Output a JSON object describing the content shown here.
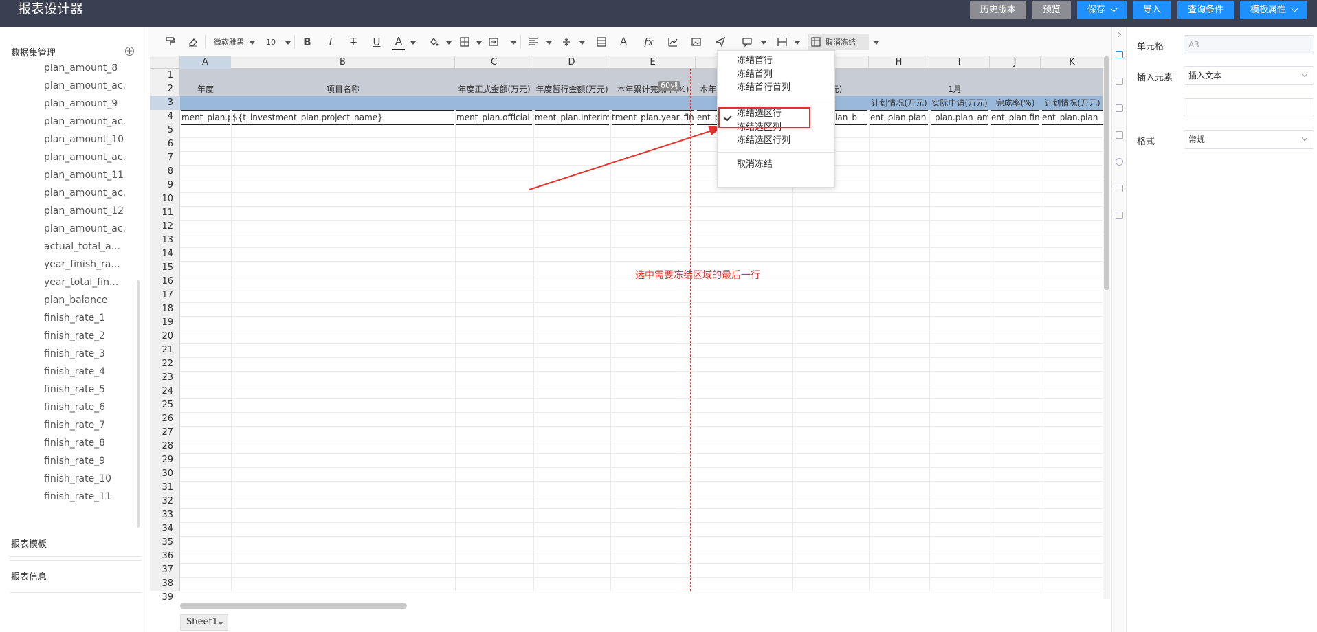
{
  "app": {
    "title": "报表设计器"
  },
  "header_buttons": [
    {
      "label": "历史版本",
      "style": "gray",
      "dropdown": false
    },
    {
      "label": "预览",
      "style": "gray",
      "dropdown": false
    },
    {
      "label": "保存",
      "style": "blue",
      "dropdown": true
    },
    {
      "label": "导入",
      "style": "blue",
      "dropdown": false
    },
    {
      "label": "查询条件",
      "style": "blue",
      "dropdown": false
    },
    {
      "label": "模板属性",
      "style": "blue",
      "dropdown": true
    }
  ],
  "left_panel": {
    "dataset_title": "数据集管理",
    "dataset_items": [
      "plan_amount_8",
      "plan_amount_ac.",
      "plan_amount_9",
      "plan_amount_ac.",
      "plan_amount_10",
      "plan_amount_ac.",
      "plan_amount_11",
      "plan_amount_ac.",
      "plan_amount_12",
      "plan_amount_ac.",
      "actual_total_a...",
      "year_finish_ra...",
      "year_total_fin...",
      "plan_balance",
      "finish_rate_1",
      "finish_rate_2",
      "finish_rate_3",
      "finish_rate_4",
      "finish_rate_5",
      "finish_rate_6",
      "finish_rate_7",
      "finish_rate_8",
      "finish_rate_9",
      "finish_rate_10",
      "finish_rate_11"
    ],
    "sections": [
      "报表模板",
      "报表信息"
    ]
  },
  "toolbar": {
    "font_family": "微软雅黑",
    "font_size": "10",
    "unfreeze_label": "取消冻结"
  },
  "grid": {
    "columns": [
      "A",
      "B",
      "C",
      "D",
      "E",
      "",
      "",
      "H",
      "I",
      "J",
      "K"
    ],
    "rows": [
      "1",
      "2",
      "3",
      "4",
      "5",
      "6",
      "7",
      "8",
      "9",
      "10",
      "11",
      "12",
      "13",
      "14",
      "15",
      "16",
      "17",
      "18",
      "19",
      "20",
      "21",
      "22",
      "23",
      "24",
      "25",
      "26",
      "27",
      "28",
      "29",
      "30",
      "31",
      "32",
      "33",
      "34",
      "35",
      "36",
      "37",
      "38",
      "39"
    ],
    "header_row2": [
      "年度",
      "项目名称",
      "年度正式金额(万元)",
      "年度暂行金额(万元)",
      "本年累计完成率(%)",
      "本年累",
      "(万元)",
      "1月"
    ],
    "header_row3": [
      "计划情况(万元)",
      "实际申请(万元)",
      "完成率(%)",
      "计划情况(万元)"
    ],
    "data_row4": [
      "ment_plan.p",
      "${t_investment_plan.project_name}",
      "ment_plan.official_p",
      "ment_plan.interim_a",
      "tment_plan.year_fini",
      "ent_p",
      "n.plan_b",
      "ent_plan.plan_",
      "_plan.plan_am",
      "ent_plan.fin",
      "ent_plan.plan_"
    ],
    "badge": "60列",
    "annotation": "选中需要冻结区域的最后一行"
  },
  "freeze_menu": {
    "items": [
      "冻结首行",
      "冻结首列",
      "冻结首行首列",
      "冻结选区行",
      "冻结选区列",
      "冻结选区行列",
      "取消冻结"
    ],
    "checked": "冻结选区行"
  },
  "right_panel": {
    "cell_label": "单元格",
    "cell_value": "A3",
    "insert_label": "插入元素",
    "insert_value": "插入文本",
    "format_label": "格式",
    "format_value": "常规"
  },
  "sheet_tab": "Sheet1"
}
